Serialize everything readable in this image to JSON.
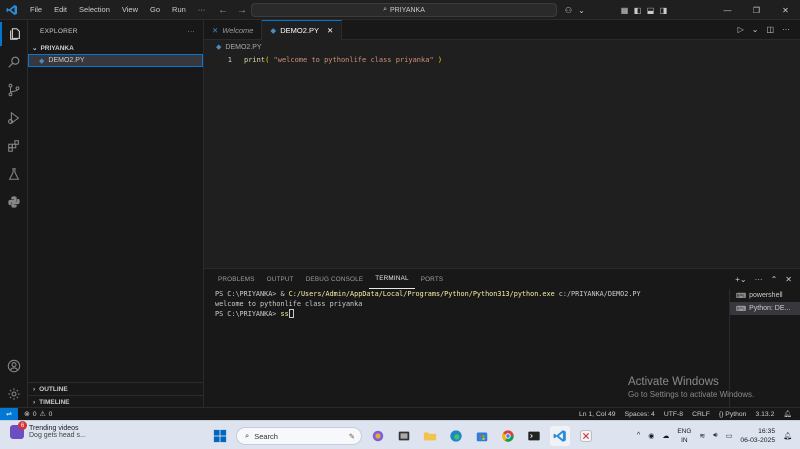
{
  "titlebar": {
    "menu": [
      "File",
      "Edit",
      "Selection",
      "View",
      "Go",
      "Run",
      "···"
    ],
    "search_text": "PRIYANKA"
  },
  "sidebar": {
    "title": "EXPLORER",
    "more": "···",
    "folder": "PRIYANKA",
    "file": "DEMO2.PY",
    "outline": "OUTLINE",
    "timeline": "TIMELINE"
  },
  "editor": {
    "tabs": [
      {
        "label": "Welcome",
        "active": false
      },
      {
        "label": "DEMO2.PY",
        "active": true
      }
    ],
    "breadcrumb": "DEMO2.PY",
    "line_number": "1",
    "code": {
      "fn": "print",
      "open": "( ",
      "string": "\"welcome to pythonlife class priyanka\"",
      "close": " )"
    }
  },
  "panel": {
    "tabs": [
      "PROBLEMS",
      "OUTPUT",
      "DEBUG CONSOLE",
      "TERMINAL",
      "PORTS"
    ],
    "active_tab": "TERMINAL",
    "terminal": {
      "line1_prompt": "PS C:\\PRIYANKA> & ",
      "line1_cmd": "C:/Users/Admin/AppData/Local/Programs/Python/Python313/python.exe",
      "line1_arg": " c:/PRIYANKA/DEMO2.PY",
      "line2": "welcome to pythonlife class priyanka",
      "line3_prompt": "PS C:\\PRIYANKA> ",
      "line3_input": "ss"
    },
    "terminals": [
      "powershell",
      "Python: DE..."
    ]
  },
  "watermark": {
    "line1": "Activate Windows",
    "line2": "Go to Settings to activate Windows."
  },
  "statusbar": {
    "errors": "0",
    "warnings": "0",
    "position": "Ln 1, Col 49",
    "spaces": "Spaces: 4",
    "encoding": "UTF-8",
    "eol": "CRLF",
    "braces": "{}",
    "language": "Python",
    "version": "3.13.2"
  },
  "taskbar": {
    "weather_badge": "6",
    "weather_title": "Trending videos",
    "weather_sub": "Dog gets head s...",
    "search_placeholder": "Search",
    "lang_line1": "ENG",
    "lang_line2": "IN",
    "time": "16:35",
    "date": "06-03-2025"
  },
  "colors": {
    "accent": "#0078d4",
    "editor_bg": "#1f1f1f",
    "sidebar_bg": "#181818",
    "string": "#ce9178",
    "function": "#dcdcaa",
    "taskbar_bg": "#dde3ef"
  }
}
